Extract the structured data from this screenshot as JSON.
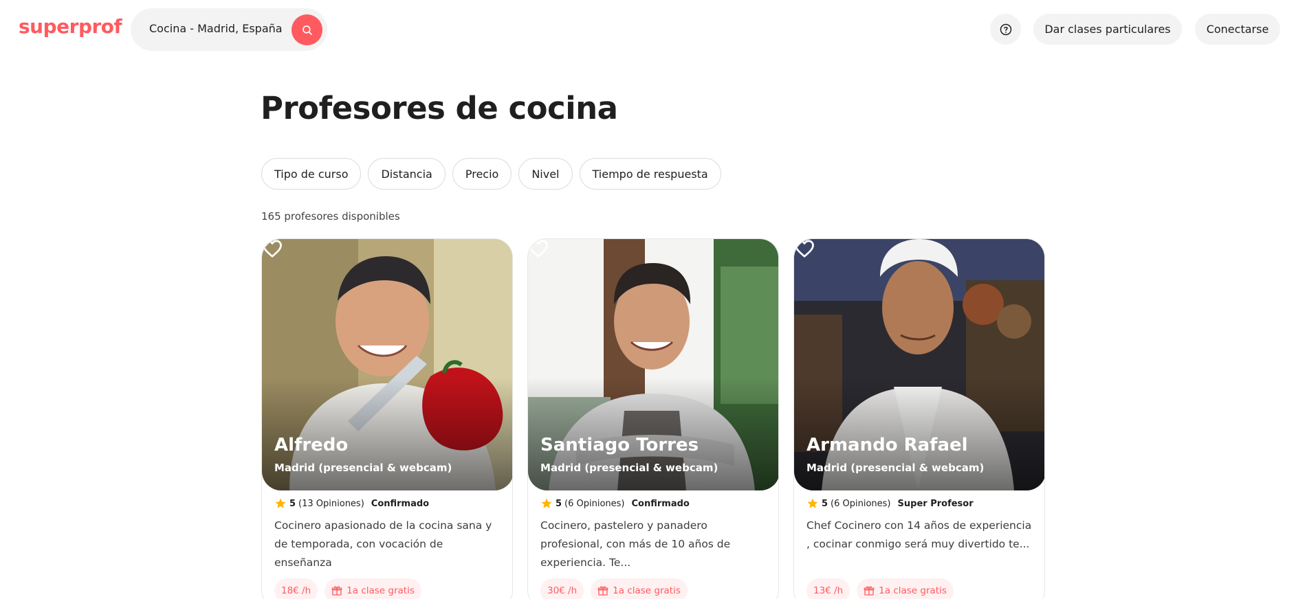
{
  "header": {
    "logo": "superprof",
    "search_value": "Cocina - Madrid, España",
    "help_icon": "question-circle-icon",
    "teach_label": "Dar clases particulares",
    "login_label": "Conectarse",
    "accent_color": "#ff5a5f"
  },
  "page": {
    "title": "Profesores de cocina",
    "count_text": "165 profesores disponibles"
  },
  "filters": [
    "Tipo de curso",
    "Distancia",
    "Precio",
    "Nivel",
    "Tiempo de respuesta"
  ],
  "cards": [
    {
      "name": "Alfredo",
      "location": "Madrid (presencial & webcam)",
      "rating": "5",
      "reviews": "(13 Opiniones)",
      "badge": "Confirmado",
      "description": "Cocinero apasionado de la cocina sana y de temporada, con vocación de enseñanza",
      "price": "18€ /h",
      "offer": "1a clase gratis"
    },
    {
      "name": "Santiago Torres",
      "location": "Madrid (presencial & webcam)",
      "rating": "5",
      "reviews": "(6 Opiniones)",
      "badge": "Confirmado",
      "description": "Cocinero, pastelero y panadero profesional, con más de 10 años de experiencia. Te...",
      "price": "30€ /h",
      "offer": "1a clase gratis"
    },
    {
      "name": "Armando Rafael",
      "location": "Madrid (presencial & webcam)",
      "rating": "5",
      "reviews": "(6 Opiniones)",
      "badge": "Super Profesor",
      "description": "Chef Cocinero con 14 años de experiencia , cocinar conmigo será muy divertido te...",
      "price": "13€ /h",
      "offer": "1a clase gratis"
    }
  ]
}
